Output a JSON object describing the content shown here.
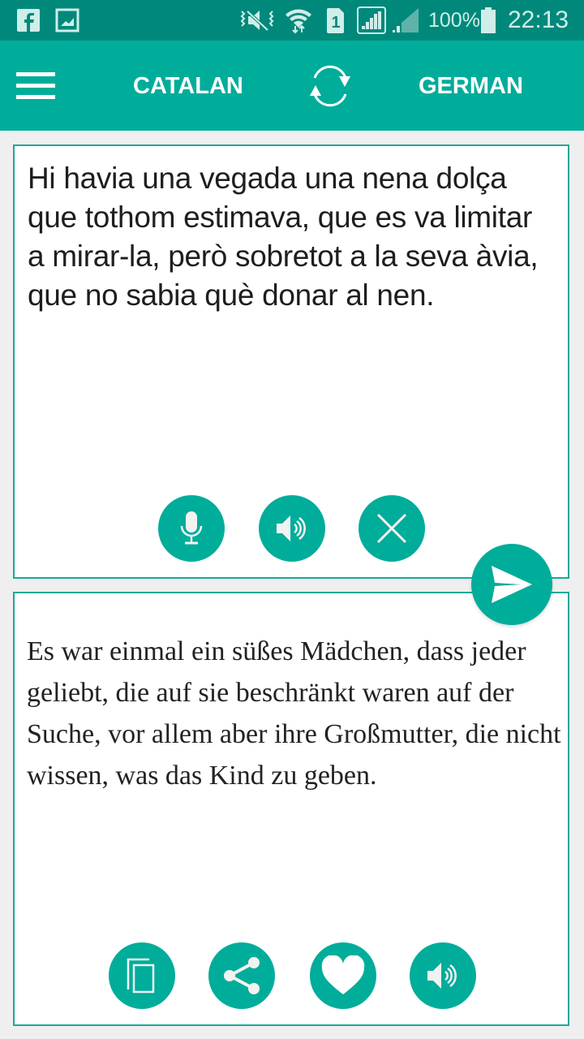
{
  "status_bar": {
    "notifications": [
      "facebook-icon",
      "image-icon"
    ],
    "indicators": [
      "vibrate-mute-icon",
      "wifi-icon",
      "sim-1-icon",
      "signal-icon",
      "signal-2-icon"
    ],
    "battery_percent": "100%",
    "time": "22:13"
  },
  "toolbar": {
    "menu_icon": "hamburger-menu-icon",
    "source_language": "CATALAN",
    "swap_icon": "swap-languages-icon",
    "target_language": "GERMAN"
  },
  "source_panel": {
    "text": "Hi havia una vegada una nena dolça que tothom estimava, que es va limitar a mirar-la, però sobretot a la seva àvia, que no sabia què donar al nen.",
    "buttons": [
      "microphone-icon",
      "speaker-icon",
      "clear-icon"
    ]
  },
  "translate_button": {
    "icon": "send-icon"
  },
  "target_panel": {
    "text": "Es war einmal ein süßes Mädchen, dass jeder geliebt, die auf sie beschränkt waren auf der Suche, vor allem aber ihre Großmutter, die nicht wissen, was das Kind zu geben.",
    "buttons": [
      "copy-icon",
      "share-icon",
      "favorite-icon",
      "speaker-icon"
    ]
  },
  "colors": {
    "status_bar": "#00897b",
    "accent": "#00ad9a",
    "background": "#efefef"
  }
}
